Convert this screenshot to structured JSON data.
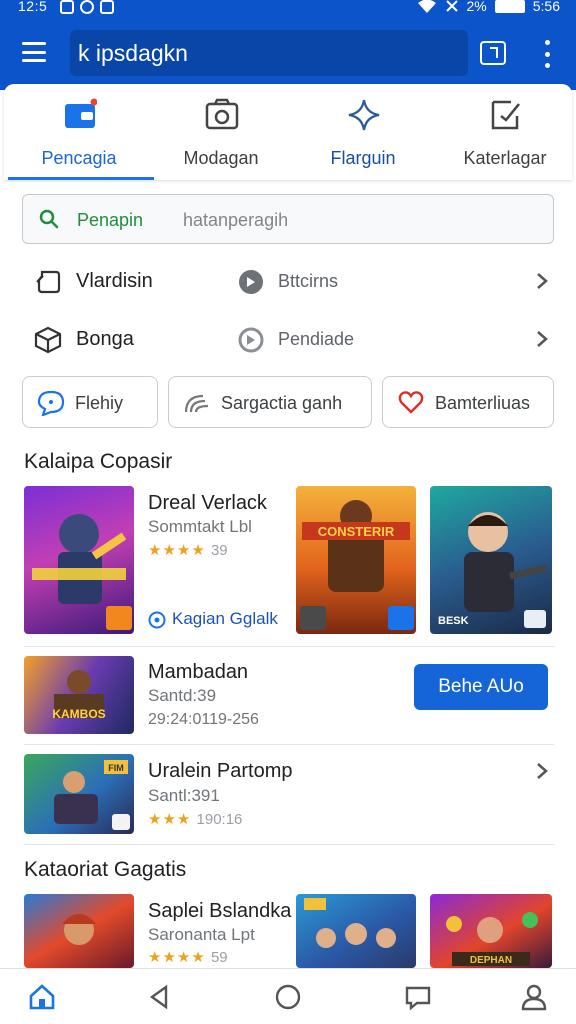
{
  "status_bar": {
    "time": "12:5",
    "battery_text": "2%",
    "clock_right": "5:56"
  },
  "app_bar": {
    "url_text": "k ipsdagkn"
  },
  "tabs": [
    {
      "label": "Pencagia",
      "icon": "wallet-icon",
      "active": true
    },
    {
      "label": "Modagan",
      "icon": "camera-icon",
      "active": false
    },
    {
      "label": "Flarguin",
      "icon": "sparkle-icon",
      "active": false
    },
    {
      "label": "Katerlagar",
      "icon": "edit-note-icon",
      "active": false
    }
  ],
  "search": {
    "query": "Penapin",
    "placeholder": "hatanperagih"
  },
  "rows": [
    {
      "label": "Vlardisin",
      "icon": "tag-icon",
      "secondary_label": "Bttcirns",
      "secondary_icon": "badge-icon"
    },
    {
      "label": "Bonga",
      "icon": "package-icon",
      "secondary_label": "Pendiade",
      "secondary_icon": "coin-icon"
    }
  ],
  "chips": [
    {
      "label": "Flehiy",
      "icon": "chat-icon"
    },
    {
      "label": "Sargactia ganh",
      "icon": "rainbow-icon"
    },
    {
      "label": "Bamterliuas",
      "icon": "heart-icon"
    }
  ],
  "section1": {
    "title": "Kalaipa Copasir",
    "featured": {
      "title": "Dreal Verlack",
      "subtitle": "Sommtakt Lbl",
      "stars": "★★★★",
      "rating": "39",
      "link_label": "Kagian Gglalk"
    },
    "thumb2_text": "CONSTERIR",
    "thumb3_text": "BESK"
  },
  "list_items": [
    {
      "title": "Mambadan",
      "subtitle": "Santd:39",
      "meta": "29:24:0119-256",
      "thumb_text": "KAMBOS",
      "button_label": "Behe AUo"
    },
    {
      "title": "Uralein Partomp",
      "subtitle": "Santl:391",
      "stars": "★★★",
      "rating": "190:16",
      "thumb_text": "FIM"
    }
  ],
  "section2": {
    "title": "Kataoriat Gagatis",
    "item": {
      "title": "Saplei Bslandka",
      "subtitle": "Saronanta Lpt",
      "stars": "★★★★",
      "rating": "59"
    },
    "thumb3_text": "DEPHAN"
  },
  "colors": {
    "primary": "#0b54c9",
    "accent": "#1a73e8",
    "star": "#f0a01c"
  }
}
